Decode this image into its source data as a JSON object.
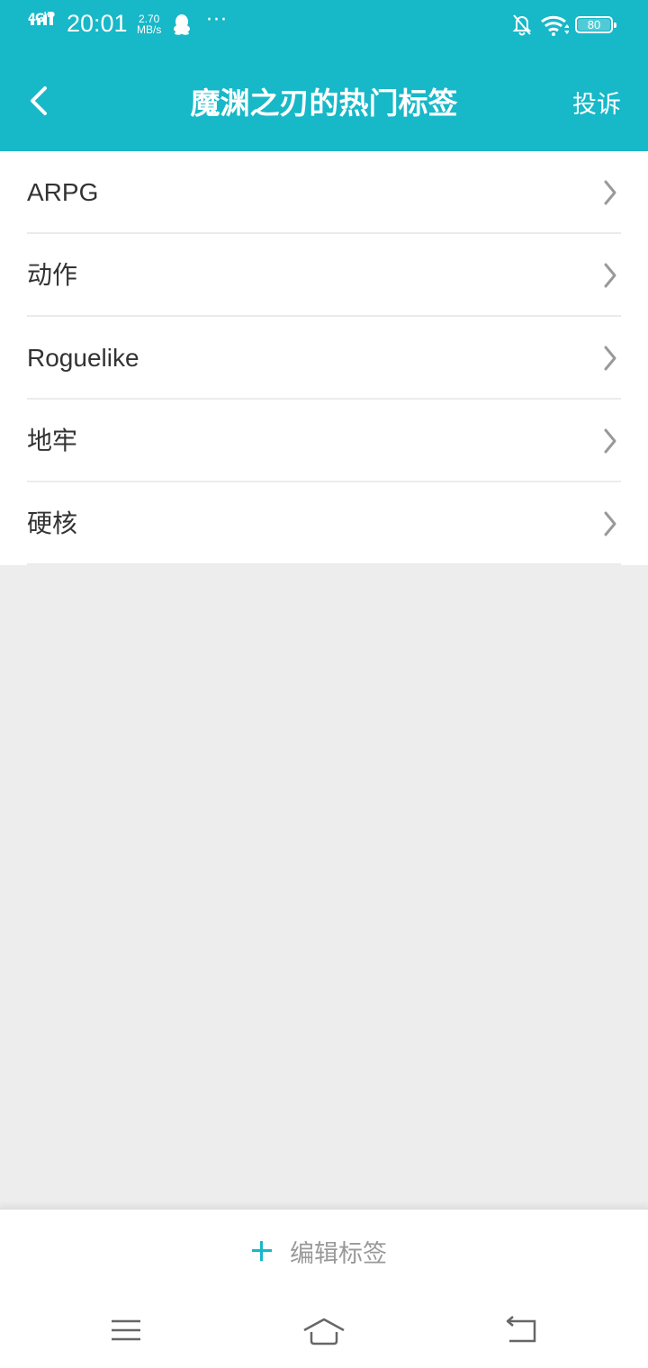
{
  "status_bar": {
    "network": "4G",
    "network_hd": "HD",
    "time": "20:01",
    "speed_value": "2.70",
    "speed_unit": "MB/s",
    "more": "···",
    "battery": "80"
  },
  "header": {
    "title": "魔渊之刃的热门标签",
    "report_label": "投诉"
  },
  "tags": [
    {
      "label": "ARPG"
    },
    {
      "label": "动作"
    },
    {
      "label": "Roguelike"
    },
    {
      "label": "地牢"
    },
    {
      "label": "硬核"
    }
  ],
  "footer": {
    "edit_label": "编辑标签"
  },
  "colors": {
    "accent": "#17b8c8",
    "background": "#ededed",
    "text": "#333333",
    "muted": "#999999"
  },
  "icons": {
    "back": "chevron-left-icon",
    "row": "chevron-right-icon",
    "edit": "plus-icon",
    "nav_menu": "menu-icon",
    "nav_home": "home-icon",
    "nav_back": "back-arrow-icon"
  }
}
